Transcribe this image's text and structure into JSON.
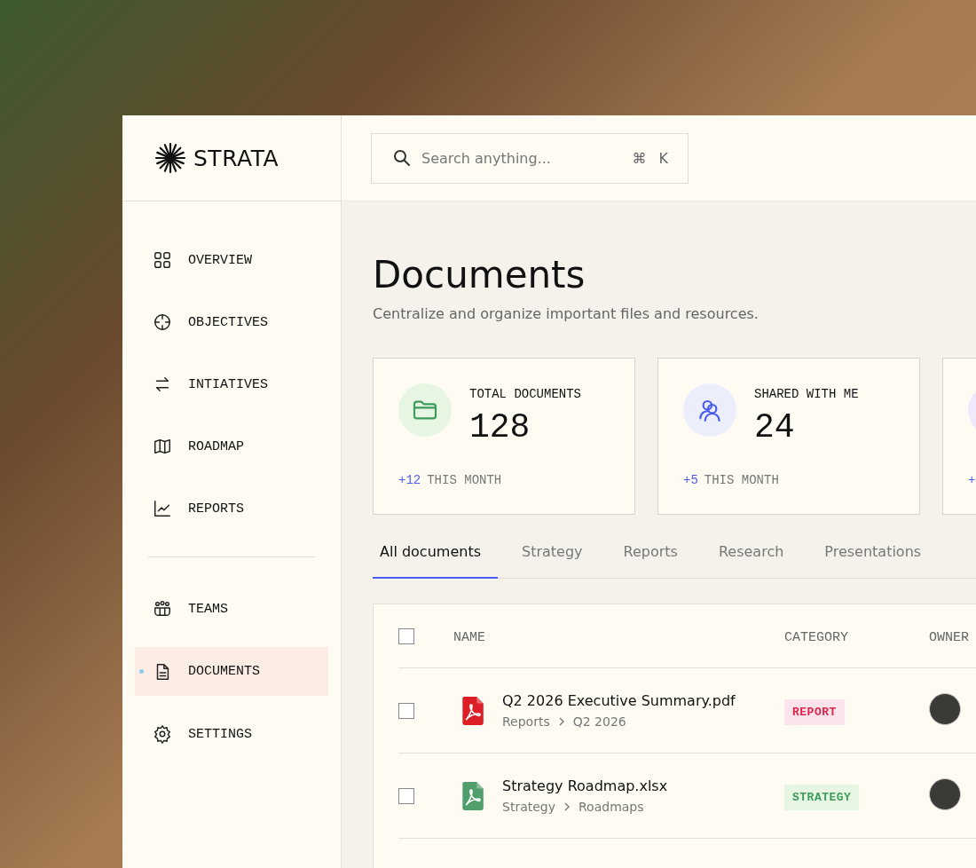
{
  "brand": {
    "name": "STRATA"
  },
  "search": {
    "placeholder": "Search anything...",
    "shortcut": [
      "⌘",
      "K"
    ]
  },
  "sidebar": {
    "groups": [
      {
        "items": [
          {
            "label": "OVERVIEW",
            "kind": "grid",
            "selected": false
          },
          {
            "label": "OBJECTIVES",
            "kind": "target",
            "selected": false
          },
          {
            "label": "INTIATIVES",
            "kind": "arrows",
            "selected": false
          },
          {
            "label": "ROADMAP",
            "kind": "map",
            "selected": false
          },
          {
            "label": "REPORTS",
            "kind": "chart",
            "selected": false
          }
        ]
      },
      {
        "items": [
          {
            "label": "TEAMS",
            "kind": "people",
            "selected": false
          },
          {
            "label": "DOCUMENTS",
            "kind": "doc",
            "selected": true
          },
          {
            "label": "SETTINGS",
            "kind": "gear",
            "selected": false
          }
        ]
      }
    ]
  },
  "header": {
    "title": "Documents",
    "subtitle": "Centralize and organize important files and resources."
  },
  "stats": [
    {
      "kind": "folder",
      "color": "#e6f6e2",
      "label": "TOTAL DOCUMENTS",
      "value": "128",
      "delta": "+12",
      "period": "THIS MONTH"
    },
    {
      "kind": "users",
      "color": "#eceefb",
      "label": "SHARED WITH ME",
      "value": "24",
      "delta": "+5",
      "period": "THIS MONTH"
    },
    {
      "kind": "partial",
      "color": "#efe9fb",
      "delta": "+"
    }
  ],
  "tabs": [
    {
      "label": "All documents",
      "selected": true
    },
    {
      "label": "Strategy",
      "selected": false
    },
    {
      "label": "Reports",
      "selected": false
    },
    {
      "label": "Research",
      "selected": false
    },
    {
      "label": "Presentations",
      "selected": false
    }
  ],
  "table": {
    "select_all": {
      "checked": false
    },
    "columns": [
      "NAME",
      "CATEGORY",
      "OWNER"
    ],
    "rows": [
      {
        "checked": false,
        "kind": "pdf",
        "name": "Q2 2026 Executive Summary.pdf",
        "path": [
          "Reports",
          "Q2 2026"
        ],
        "category": {
          "label": "REPORT",
          "kind": "report"
        }
      },
      {
        "checked": false,
        "kind": "xlsx",
        "name": "Strategy Roadmap.xlsx",
        "path": [
          "Strategy",
          "Roadmaps"
        ],
        "category": {
          "label": "STRATEGY",
          "kind": "strategy"
        }
      }
    ]
  }
}
